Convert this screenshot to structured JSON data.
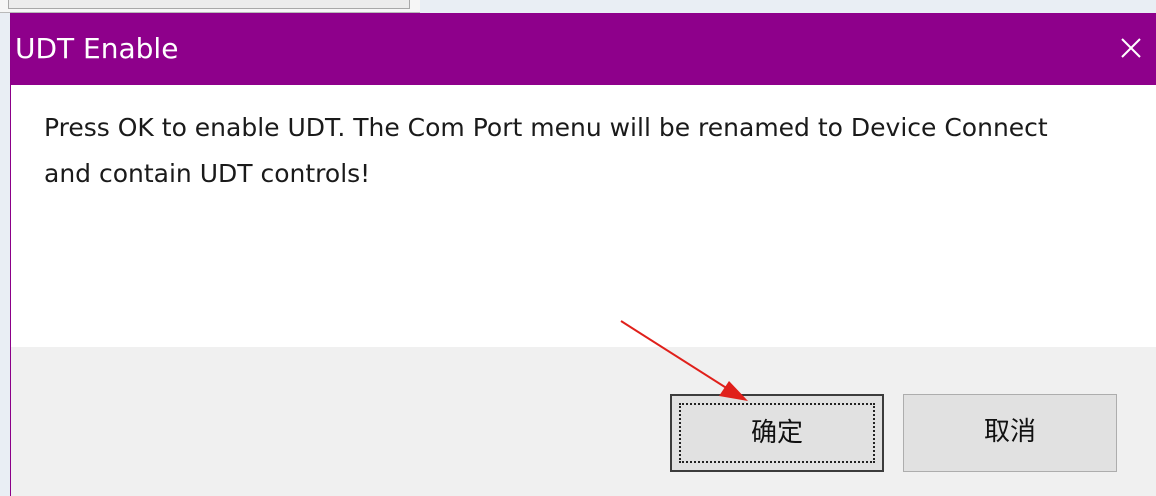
{
  "dialog": {
    "title": "UDT Enable",
    "close_icon": "close-icon",
    "message": "Press OK to enable UDT. The Com Port menu will be renamed to Device Connect and contain UDT controls!",
    "ok_label": "确定",
    "cancel_label": "取消"
  },
  "colors": {
    "titlebar": "#8e008b",
    "annotation_arrow": "#e0201b",
    "footer": "#f0f0f0"
  }
}
